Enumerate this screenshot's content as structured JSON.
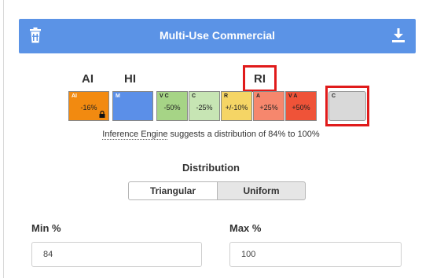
{
  "header": {
    "title": "Multi-Use Commercial",
    "trash_icon": "trash-icon",
    "download_icon": "download-icon",
    "background": "#5b93e6"
  },
  "groups": {
    "ai": "AI",
    "hi": "HI",
    "ri": "RI"
  },
  "cells": [
    {
      "abbr": "AI",
      "value": "-16%",
      "color": "#f28a10",
      "locked": true
    },
    {
      "abbr": "M",
      "value": "",
      "color": "#5b8fe8",
      "locked": false
    },
    {
      "abbr": "V C",
      "value": "-50%",
      "color": "#a6d486",
      "locked": false
    },
    {
      "abbr": "C",
      "value": "-25%",
      "color": "#c7e5b4",
      "locked": false
    },
    {
      "abbr": "R",
      "value": "+/-10%",
      "color": "#f5d565",
      "locked": false
    },
    {
      "abbr": "A",
      "value": "+25%",
      "color": "#f6876d",
      "locked": false
    },
    {
      "abbr": "V A",
      "value": "+50%",
      "color": "#ef5338",
      "locked": false
    },
    {
      "abbr": "C",
      "value": "",
      "color": "#d9d9d9",
      "locked": false
    }
  ],
  "hint": {
    "underlined": "Inference Engine",
    "rest": " suggests a distribution of 84% to 100%"
  },
  "distribution": {
    "label": "Distribution",
    "options": [
      "Triangular",
      "Uniform"
    ],
    "selected": "Uniform"
  },
  "min": {
    "label": "Min %",
    "value": "84"
  },
  "max": {
    "label": "Max %",
    "value": "100"
  },
  "highlight_color": "#e01b1b"
}
